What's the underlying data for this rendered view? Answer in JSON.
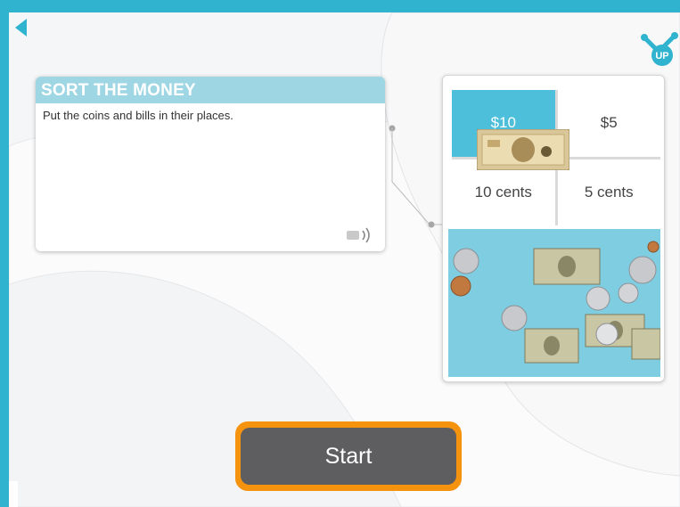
{
  "activity": {
    "title": "SORT THE MONEY",
    "instruction": "Put the coins and bills in their places."
  },
  "preview": {
    "categories": [
      "$10",
      "$5",
      "10 cents",
      "5 cents"
    ],
    "selected_category": "$10"
  },
  "start_label": "Start",
  "logo_text": "UP",
  "icons": {
    "back": "back-arrow-icon",
    "audio": "audio-speaker-icon",
    "logo": "molecule-logo-icon"
  },
  "colors": {
    "frame": "#2fb3cf",
    "header": "#9fd6e3",
    "accent_cell": "#4dbfdb",
    "start_button": "#5e5e60",
    "start_outline": "#f5930e"
  }
}
